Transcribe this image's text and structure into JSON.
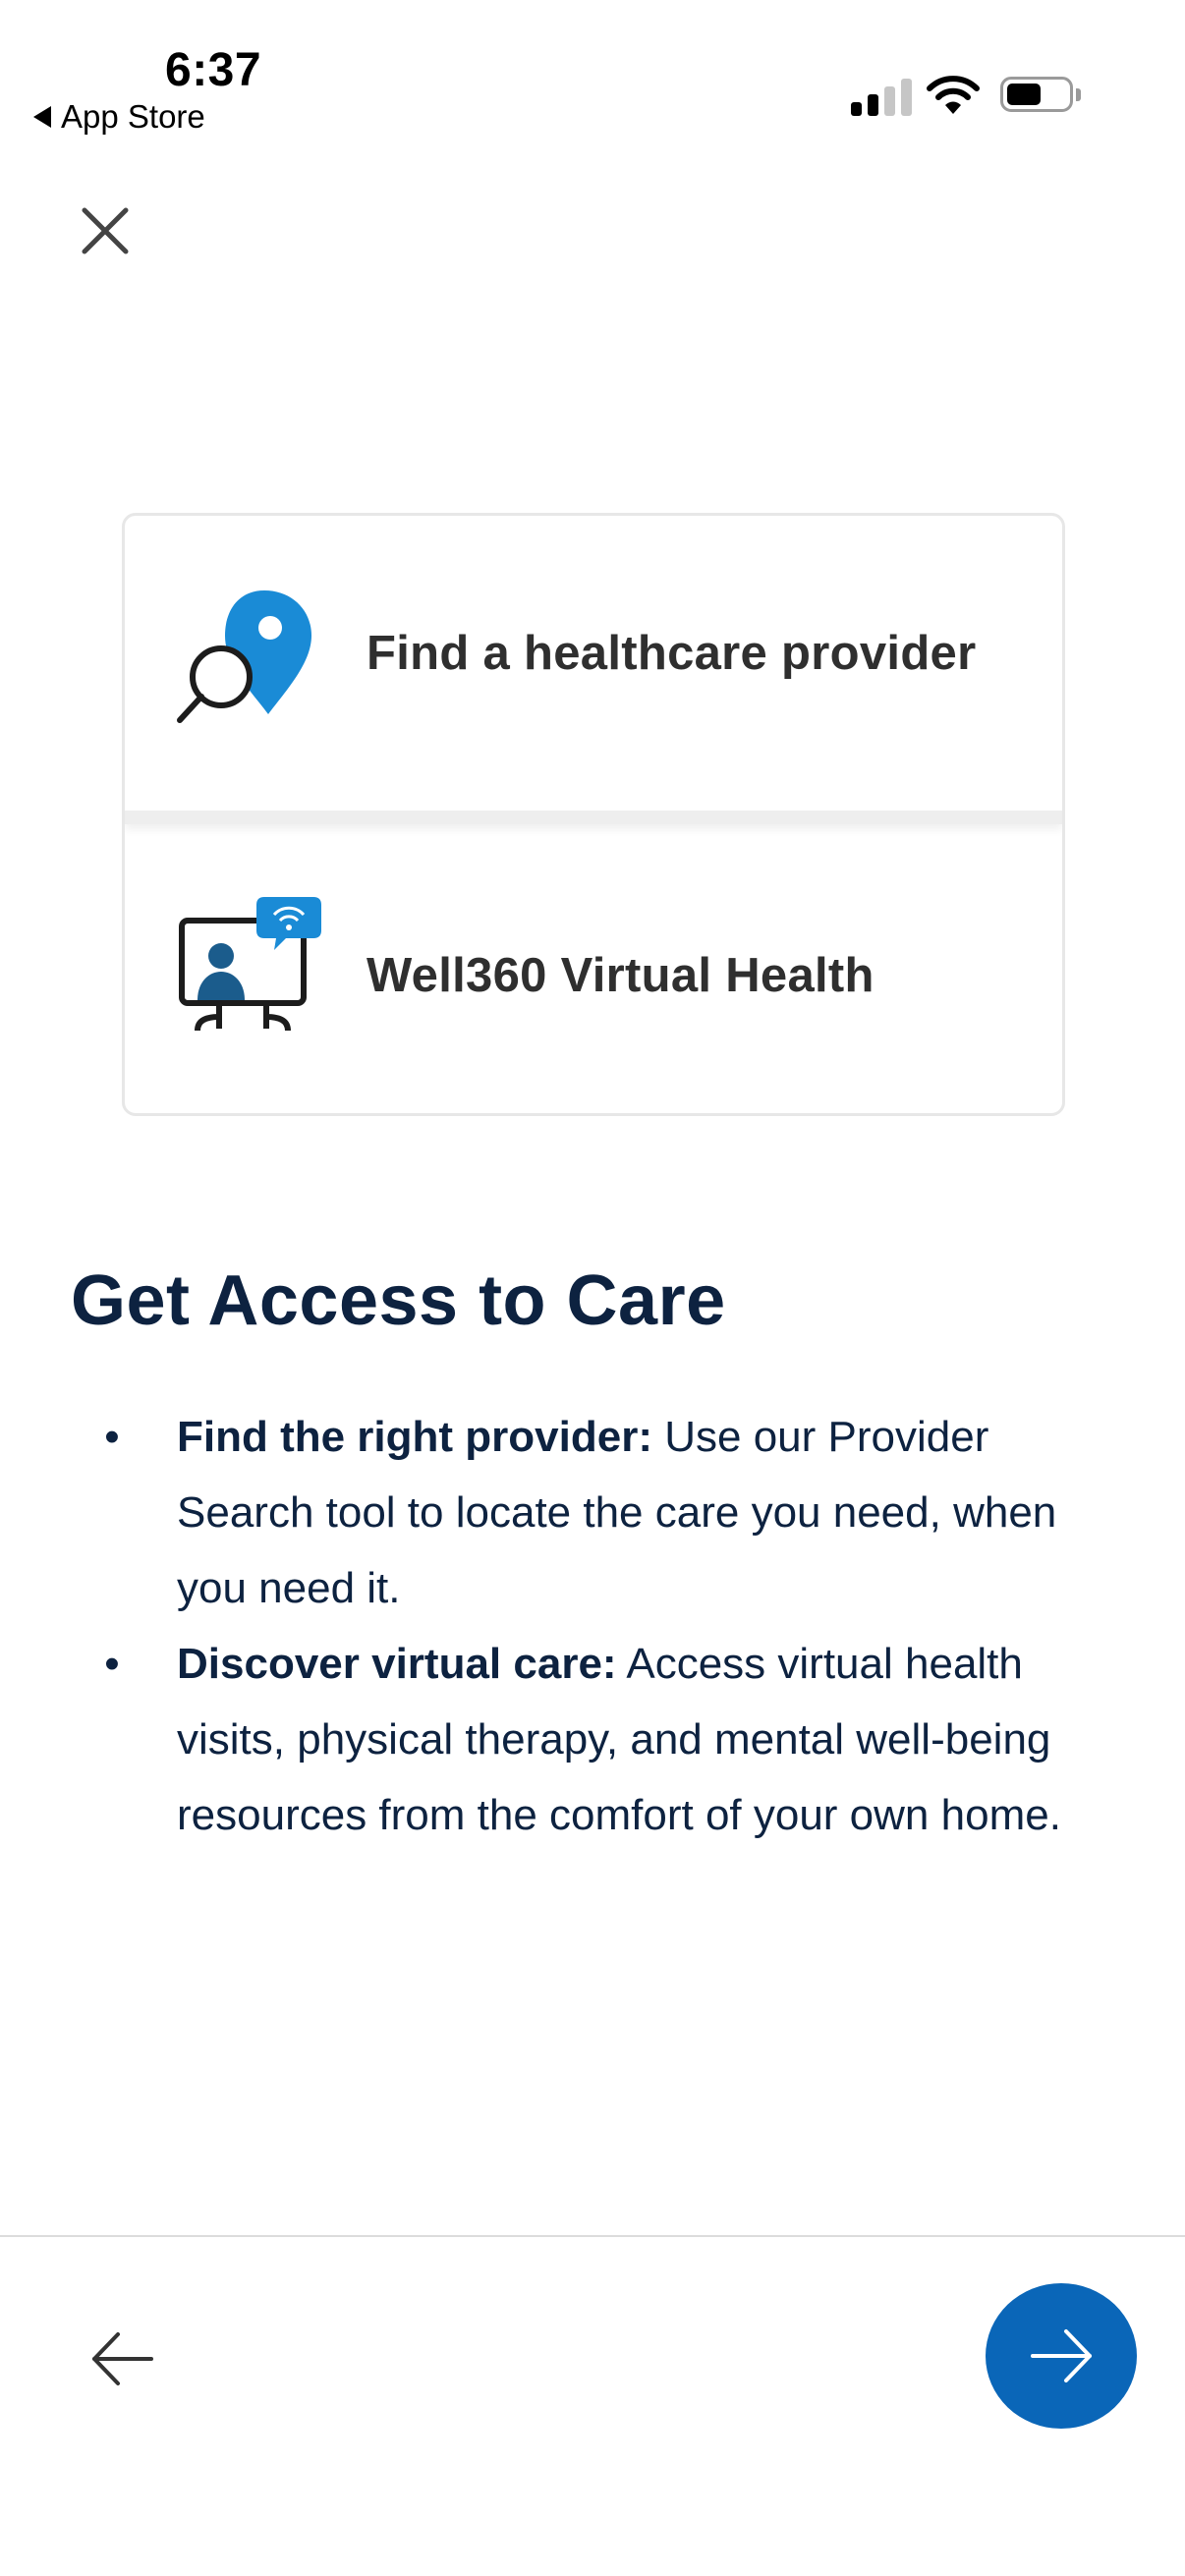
{
  "status_bar": {
    "time": "6:37",
    "back_app_label": "App Store",
    "icons": [
      "signal-icon",
      "wifi-icon",
      "battery-icon"
    ]
  },
  "header": {
    "close_icon": "close-icon"
  },
  "cards": [
    {
      "label": "Find a healthcare provider",
      "icon": "provider-search-icon",
      "accent": "#1a8bd6"
    },
    {
      "label": "Well360 Virtual Health",
      "icon": "virtual-health-icon",
      "accent": "#1a8bd6"
    }
  ],
  "content": {
    "title": "Get Access to Care",
    "bullets": [
      {
        "bold": "Find the right provider:",
        "text": "Use our Provider Search tool to locate the care you need, when you need it."
      },
      {
        "bold": "Discover virtual care:",
        "text": "Access virtual health visits, physical therapy, and mental well-being resources from the comfort of your own home."
      }
    ]
  },
  "footer": {
    "back_icon": "arrow-left-icon",
    "next_icon": "arrow-right-icon",
    "next_color": "#0a66b8"
  }
}
